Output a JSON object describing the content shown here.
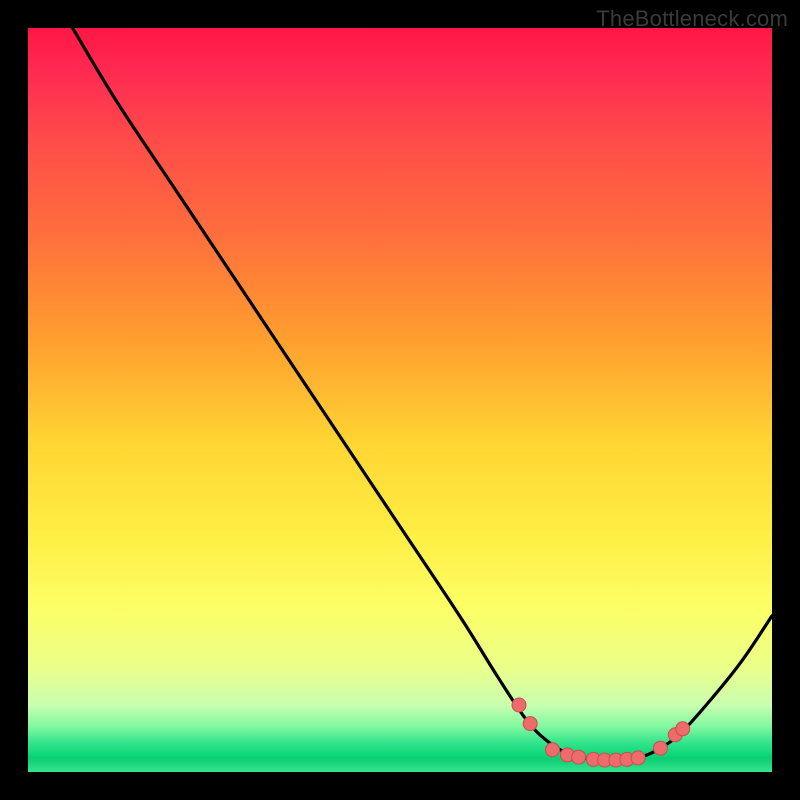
{
  "watermark": {
    "text": "TheBottleneck.com"
  },
  "colors": {
    "background": "#000000",
    "curve_stroke": "#000000",
    "marker_fill": "#ed6b6b",
    "marker_stroke": "#c94f4f"
  },
  "chart_data": {
    "type": "line",
    "title": "",
    "xlabel": "",
    "ylabel": "",
    "xlim": [
      0,
      100
    ],
    "ylim": [
      0,
      100
    ],
    "grid": false,
    "curve": [
      {
        "x": 6,
        "y": 100
      },
      {
        "x": 12,
        "y": 90
      },
      {
        "x": 20,
        "y": 78
      },
      {
        "x": 30,
        "y": 63
      },
      {
        "x": 40,
        "y": 48
      },
      {
        "x": 50,
        "y": 33
      },
      {
        "x": 58,
        "y": 21
      },
      {
        "x": 63,
        "y": 13
      },
      {
        "x": 67,
        "y": 7
      },
      {
        "x": 70,
        "y": 4
      },
      {
        "x": 73,
        "y": 2.3
      },
      {
        "x": 76,
        "y": 1.7
      },
      {
        "x": 79,
        "y": 1.6
      },
      {
        "x": 82,
        "y": 1.9
      },
      {
        "x": 85,
        "y": 3.2
      },
      {
        "x": 88,
        "y": 5.5
      },
      {
        "x": 92,
        "y": 10
      },
      {
        "x": 96,
        "y": 15
      },
      {
        "x": 100,
        "y": 21
      }
    ],
    "markers": [
      {
        "x": 66,
        "y": 9.0
      },
      {
        "x": 67.5,
        "y": 6.5
      },
      {
        "x": 70.5,
        "y": 3.0
      },
      {
        "x": 72.5,
        "y": 2.3
      },
      {
        "x": 74.0,
        "y": 2.0
      },
      {
        "x": 76.0,
        "y": 1.7
      },
      {
        "x": 77.5,
        "y": 1.6
      },
      {
        "x": 79.0,
        "y": 1.6
      },
      {
        "x": 80.5,
        "y": 1.7
      },
      {
        "x": 82.0,
        "y": 1.9
      },
      {
        "x": 85.0,
        "y": 3.2
      },
      {
        "x": 87.0,
        "y": 5.0
      },
      {
        "x": 88.0,
        "y": 5.8
      }
    ]
  }
}
